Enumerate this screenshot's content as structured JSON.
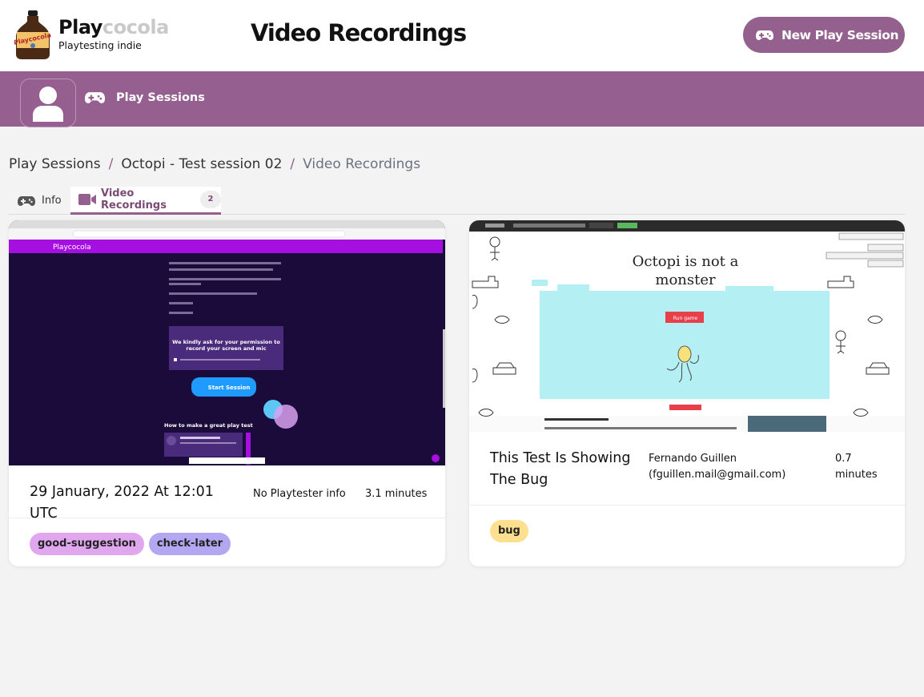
{
  "header": {
    "brand_primary": "Play",
    "brand_secondary": "cocola",
    "tagline": "Playtesting indie",
    "page_title": "Video Recordings",
    "new_session_label": "New Play Session",
    "logo_label": "Playcocola"
  },
  "nav": {
    "play_sessions_label": "Play Sessions"
  },
  "breadcrumb": [
    "Play Sessions",
    "Octopi - Test session 02",
    "Video Recordings"
  ],
  "breadcrumb_sep": "/",
  "tabs": {
    "info_label": "Info",
    "video_label": "Video Recordings",
    "video_count": "2"
  },
  "recordings": [
    {
      "title": "29 January, 2022 At 12:01 UTC",
      "playtester": "No Playtester info",
      "duration": "3.1 minutes",
      "tags": [
        "good-suggestion",
        "check-later"
      ],
      "thumb": {
        "site_title": "Playcocola",
        "permission_title": "We kindly ask for your permission to record your screen and mic",
        "start_button": "Start Session",
        "tips_title": "How to make a great play test"
      }
    },
    {
      "title": "This Test Is Showing The Bug",
      "playtester_name": "Fernando Guillen",
      "playtester_email": "(fguillen.mail@gmail.com)",
      "duration_value": "0.7",
      "duration_unit": "minutes",
      "tags": [
        "bug"
      ],
      "thumb": {
        "game_title_line1": "Octopi is not a",
        "game_title_line2": "monster",
        "run_button": "Run game"
      }
    }
  ],
  "tag_colors": {
    "good-suggestion": "#e0a7ef",
    "check-later": "#b3a7f2",
    "bug": "#fde08f"
  },
  "colors": {
    "brand_purple": "#95608f",
    "button_purple": "#94608e"
  }
}
